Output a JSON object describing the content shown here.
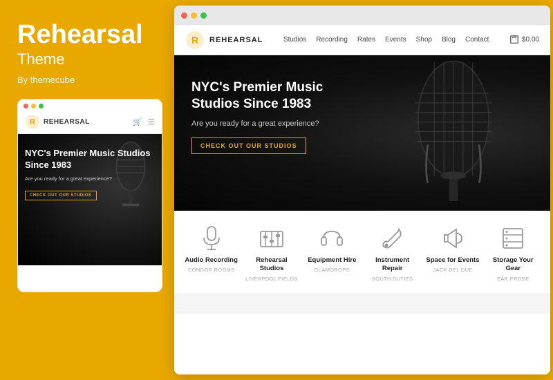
{
  "left": {
    "title": "Rehearsal",
    "subtitle": "Theme",
    "by": "By themecube",
    "mobile": {
      "logo_text": "REHEARSAL",
      "hero_title": "NYC's Premier Music Studios Since 1983",
      "hero_sub": "Are you ready for a great experience?",
      "cta_btn": "CHECK OUT OUR STUDIOS"
    }
  },
  "browser": {
    "nav": {
      "logo_text": "REHEARSAL",
      "links": [
        "Studios",
        "Recording",
        "Rates",
        "Events",
        "Shop",
        "Blog",
        "Contact"
      ],
      "cart_label": "$0.00"
    },
    "hero": {
      "title": "NYC's Premier Music Studios Since 1983",
      "subtitle": "Are you ready for a great experience?",
      "cta_btn": "CHECK OUT OUR STUDIOS"
    },
    "services": [
      {
        "name": "Audio Recording",
        "sub": "CONDOR ROOMS"
      },
      {
        "name": "Rehearsal Studios",
        "sub": "LIVERPOOL FIELDS"
      },
      {
        "name": "Equipment Hire",
        "sub": "GLAMOROPS"
      },
      {
        "name": "Instrument Repair",
        "sub": "SOUTH DUTIES"
      },
      {
        "name": "Space for Events",
        "sub": "JACK DEL DUE"
      },
      {
        "name": "Storage Your Gear",
        "sub": "EAR PROBE"
      }
    ]
  },
  "accent_color": "#E8A800",
  "icons": {
    "mic": "🎙",
    "guitar": "🎸",
    "studio": "🎛",
    "hammer": "🔧",
    "stage": "🏟",
    "storage": "📦"
  }
}
